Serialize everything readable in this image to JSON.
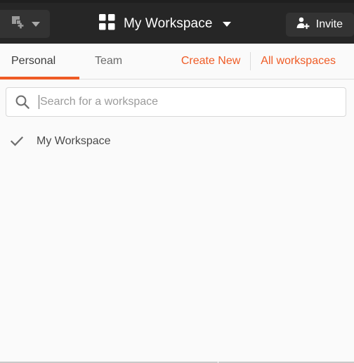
{
  "header": {
    "new_button": {
      "icon": "new-item-icon",
      "caret_icon": "chevron-down-icon"
    },
    "workspace": {
      "grid_icon": "grid-icon",
      "title": "My Workspace",
      "caret_icon": "chevron-down-icon"
    },
    "invite": {
      "icon": "add-person-icon",
      "label": "Invite"
    },
    "background_color": "#262626",
    "button_color": "#333333"
  },
  "panel": {
    "tabs": [
      {
        "label": "Personal",
        "active": true
      },
      {
        "label": "Team",
        "active": false
      }
    ],
    "links": [
      {
        "label": "Create New"
      },
      {
        "label": "All workspaces"
      }
    ],
    "search": {
      "icon": "search-icon",
      "value": "",
      "placeholder": "Search for a workspace"
    },
    "workspaces": [
      {
        "label": "My Workspace",
        "selected": true,
        "check_icon": "check-icon"
      }
    ],
    "accent_color": "#ef5b25",
    "background_color": "#fafafa"
  }
}
